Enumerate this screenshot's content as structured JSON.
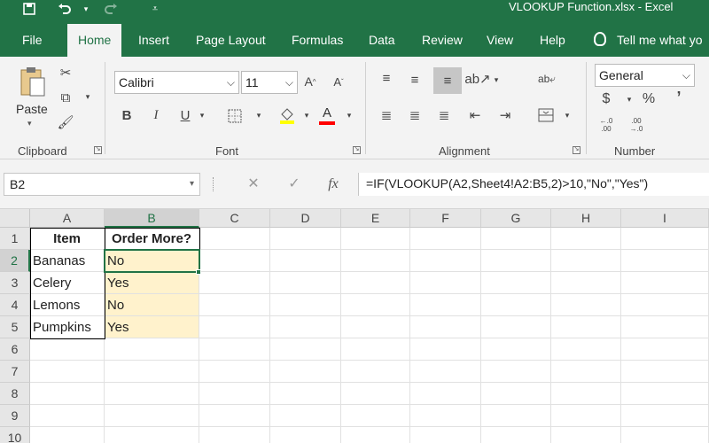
{
  "window": {
    "title": "VLOOKUP Function.xlsx  -  Excel"
  },
  "quick_access": [
    "save-icon",
    "undo-icon",
    "redo-icon",
    "customize-icon"
  ],
  "tabs": [
    {
      "label": "File"
    },
    {
      "label": "Home",
      "active": true
    },
    {
      "label": "Insert"
    },
    {
      "label": "Page Layout"
    },
    {
      "label": "Formulas"
    },
    {
      "label": "Data"
    },
    {
      "label": "Review"
    },
    {
      "label": "View"
    },
    {
      "label": "Help"
    }
  ],
  "tell_me": "Tell me what yo",
  "ribbon": {
    "clipboard": {
      "label": "Clipboard",
      "paste_label": "Paste"
    },
    "font": {
      "label": "Font",
      "font_name": "Calibri",
      "font_size": "11"
    },
    "alignment": {
      "label": "Alignment"
    },
    "number": {
      "label": "Number",
      "format": "General",
      "currency_symbol": "$",
      "percent_symbol": "%",
      "comma_symbol": "’"
    }
  },
  "formula_bar": {
    "name_box": "B2",
    "fx_label": "fx",
    "formula": "=IF(VLOOKUP(A2,Sheet4!A2:B5,2)>10,\"No\",\"Yes\")"
  },
  "grid": {
    "columns": [
      "A",
      "B",
      "C",
      "D",
      "E",
      "F",
      "G",
      "H",
      "I"
    ],
    "rows": [
      "1",
      "2",
      "3",
      "4",
      "5",
      "6",
      "7",
      "8",
      "9",
      "10"
    ],
    "selected_cell": "B2",
    "cells": {
      "A1": "Item",
      "B1": "Order More?",
      "A2": "Bananas",
      "B2": "No",
      "A3": "Celery",
      "B3": "Yes",
      "A4": "Lemons",
      "B4": "No",
      "A5": "Pumpkins",
      "B5": "Yes"
    }
  },
  "colors": {
    "accent": "#217346",
    "highlight_fill": "#fff2cc",
    "font_color_bar": "#ff0000"
  }
}
